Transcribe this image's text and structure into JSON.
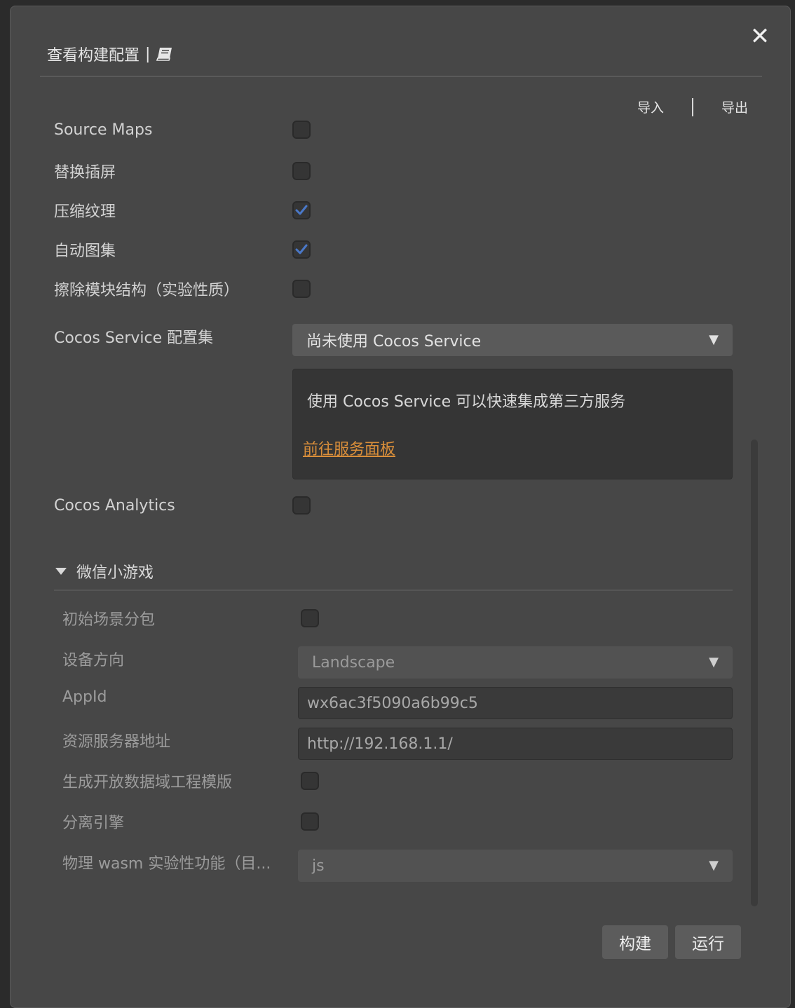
{
  "dialog": {
    "title": "查看构建配置",
    "title_separator": "|",
    "doc_icon": "book-icon",
    "close_icon": "close-icon"
  },
  "toolbar": {
    "import_label": "导入",
    "export_label": "导出"
  },
  "options": [
    {
      "label": "Source Maps",
      "checked": false
    },
    {
      "label": "替换插屏",
      "checked": false
    },
    {
      "label": "压缩纹理",
      "checked": true
    },
    {
      "label": "自动图集",
      "checked": true
    },
    {
      "label": "擦除模块结构（实验性质）",
      "checked": false
    }
  ],
  "cocos_service": {
    "label": "Cocos Service 配置集",
    "selected": "尚未使用 Cocos Service",
    "info_text": "使用 Cocos Service 可以快速集成第三方服务",
    "link_text": "前往服务面板"
  },
  "analytics": {
    "label": "Cocos Analytics",
    "checked": false
  },
  "wechat": {
    "section_title": "微信小游戏",
    "initial_scene_subpackage": {
      "label": "初始场景分包",
      "checked": false
    },
    "orientation": {
      "label": "设备方向",
      "selected": "Landscape"
    },
    "appid": {
      "label": "AppId",
      "value": "wx6ac3f5090a6b99c5"
    },
    "remote_server": {
      "label": "资源服务器地址",
      "value": "http://192.168.1.1/"
    },
    "open_data_template": {
      "label": "生成开放数据域工程模版",
      "checked": false
    },
    "separate_engine": {
      "label": "分离引擎",
      "checked": false
    },
    "physics_wasm": {
      "label": "物理 wasm 实验性功能（目...",
      "selected": "js"
    }
  },
  "footer": {
    "build_label": "构建",
    "run_label": "运行"
  },
  "colors": {
    "accent_check": "#4a78c8",
    "link": "#d98e3a"
  }
}
